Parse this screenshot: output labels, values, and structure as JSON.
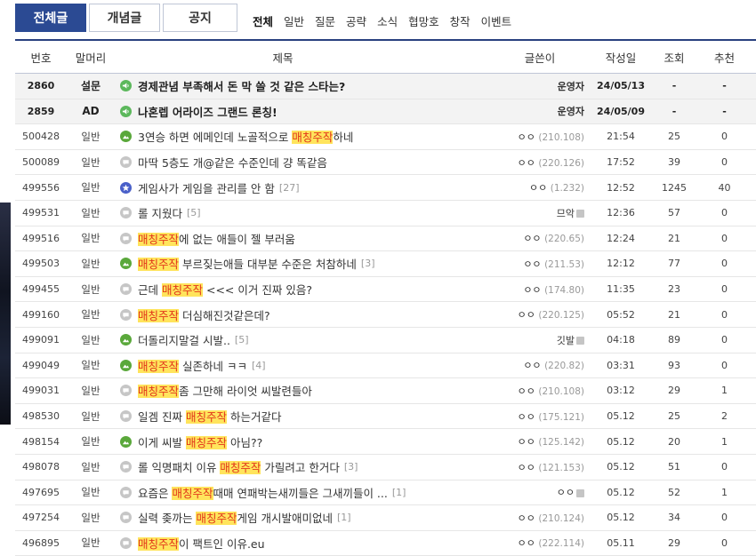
{
  "tabs": [
    {
      "label": "전체글",
      "active": true
    },
    {
      "label": "개념글",
      "active": false
    },
    {
      "label": "공지",
      "active": false
    }
  ],
  "categories": [
    {
      "label": "전체",
      "active": true
    },
    {
      "label": "일반",
      "active": false
    },
    {
      "label": "질문",
      "active": false
    },
    {
      "label": "공략",
      "active": false
    },
    {
      "label": "소식",
      "active": false
    },
    {
      "label": "협망호",
      "active": false
    },
    {
      "label": "창작",
      "active": false
    },
    {
      "label": "이벤트",
      "active": false
    }
  ],
  "columns": {
    "num": "번호",
    "head": "말머리",
    "title": "제목",
    "writer": "글쓴이",
    "date": "작성일",
    "views": "조회",
    "rec": "추천"
  },
  "rows": [
    {
      "num": "2860",
      "head": "설문",
      "icon": "speaker-icon",
      "notice": true,
      "parts": [
        [
          "경제관념 부족해서 돈 막 쓸 것 같은 스타는?",
          false
        ]
      ],
      "count": "",
      "writer": "운영자",
      "ip": "",
      "date": "24/05/13",
      "views": "-",
      "rec": "-"
    },
    {
      "num": "2859",
      "head": "AD",
      "icon": "speaker-icon",
      "notice": true,
      "parts": [
        [
          "나혼렙 어라이즈 그랜드 론칭!",
          false
        ]
      ],
      "count": "",
      "writer": "운영자",
      "ip": "",
      "date": "24/05/09",
      "views": "-",
      "rec": "-"
    },
    {
      "num": "500428",
      "head": "일반",
      "icon": "image-post-icon",
      "parts": [
        [
          "3연승 하면 에메인데 노골적으로 ",
          false
        ],
        [
          "매칭주작",
          true
        ],
        [
          "하네",
          false
        ]
      ],
      "count": "",
      "writer": "ㅇㅇ",
      "ip": "(210.108)",
      "date": "21:54",
      "views": "25",
      "rec": "0"
    },
    {
      "num": "500089",
      "head": "일반",
      "icon": "text-post-icon",
      "parts": [
        [
          "마딱 5층도 개@같은 수준인데 걍 똑같음",
          false
        ]
      ],
      "count": "",
      "writer": "ㅇㅇ",
      "ip": "(220.126)",
      "date": "17:52",
      "views": "39",
      "rec": "0"
    },
    {
      "num": "499556",
      "head": "일반",
      "icon": "star-post-icon",
      "parts": [
        [
          "게임사가 게임을 관리를 안 함",
          false
        ]
      ],
      "count": "[27]",
      "writer": "ㅇㅇ",
      "ip": "(1.232)",
      "date": "12:52",
      "views": "1245",
      "rec": "40"
    },
    {
      "num": "499531",
      "head": "일반",
      "icon": "text-post-icon",
      "parts": [
        [
          "롤 지웠다",
          false
        ]
      ],
      "count": "[5]",
      "writer": "므악",
      "ip": "",
      "date": "12:36",
      "views": "57",
      "rec": "0",
      "level": true
    },
    {
      "num": "499516",
      "head": "일반",
      "icon": "text-post-icon",
      "parts": [
        [
          "매칭주작",
          true
        ],
        [
          "에 없는 애들이 젤 부러움",
          false
        ]
      ],
      "count": "",
      "writer": "ㅇㅇ",
      "ip": "(220.65)",
      "date": "12:24",
      "views": "21",
      "rec": "0"
    },
    {
      "num": "499503",
      "head": "일반",
      "icon": "image-post-icon",
      "parts": [
        [
          "매칭주작",
          true
        ],
        [
          " 부르짖는애들 대부분 수준은 처참하네",
          false
        ]
      ],
      "count": "[3]",
      "writer": "ㅇㅇ",
      "ip": "(211.53)",
      "date": "12:12",
      "views": "77",
      "rec": "0"
    },
    {
      "num": "499455",
      "head": "일반",
      "icon": "text-post-icon",
      "parts": [
        [
          "근데 ",
          false
        ],
        [
          "매칭주작",
          true
        ],
        [
          " <<< 이거 진짜 있음?",
          false
        ]
      ],
      "count": "",
      "writer": "ㅇㅇ",
      "ip": "(174.80)",
      "date": "11:35",
      "views": "23",
      "rec": "0"
    },
    {
      "num": "499160",
      "head": "일반",
      "icon": "text-post-icon",
      "parts": [
        [
          "매칭주작",
          true
        ],
        [
          " 더심해진것같은데?",
          false
        ]
      ],
      "count": "",
      "writer": "ㅇㅇ",
      "ip": "(220.125)",
      "date": "05:52",
      "views": "21",
      "rec": "0"
    },
    {
      "num": "499091",
      "head": "일반",
      "icon": "image-post-icon",
      "parts": [
        [
          "더돌리지말걸 시발..",
          false
        ]
      ],
      "count": "[5]",
      "writer": "깃발",
      "ip": "",
      "date": "04:18",
      "views": "89",
      "rec": "0",
      "level": true
    },
    {
      "num": "499049",
      "head": "일반",
      "icon": "image-post-icon",
      "parts": [
        [
          "매칭주작",
          true
        ],
        [
          " 실존하네 ㅋㅋ",
          false
        ]
      ],
      "count": "[4]",
      "writer": "ㅇㅇ",
      "ip": "(220.82)",
      "date": "03:31",
      "views": "93",
      "rec": "0"
    },
    {
      "num": "499031",
      "head": "일반",
      "icon": "text-post-icon",
      "parts": [
        [
          "매칭주작",
          true
        ],
        [
          "좀 그만해 라이엇 씨발련들아",
          false
        ]
      ],
      "count": "",
      "writer": "ㅇㅇ",
      "ip": "(210.108)",
      "date": "03:12",
      "views": "29",
      "rec": "1"
    },
    {
      "num": "498530",
      "head": "일반",
      "icon": "text-post-icon",
      "parts": [
        [
          "일겜 진짜 ",
          false
        ],
        [
          "매칭주작",
          true
        ],
        [
          " 하는거같다",
          false
        ]
      ],
      "count": "",
      "writer": "ㅇㅇ",
      "ip": "(175.121)",
      "date": "05.12",
      "views": "25",
      "rec": "2"
    },
    {
      "num": "498154",
      "head": "일반",
      "icon": "image-post-icon",
      "parts": [
        [
          "이게 씨발 ",
          false
        ],
        [
          "매칭주작",
          true
        ],
        [
          " 아님??",
          false
        ]
      ],
      "count": "",
      "writer": "ㅇㅇ",
      "ip": "(125.142)",
      "date": "05.12",
      "views": "20",
      "rec": "1"
    },
    {
      "num": "498078",
      "head": "일반",
      "icon": "text-post-icon",
      "parts": [
        [
          "롤 익명패치 이유 ",
          false
        ],
        [
          "매칭주작",
          true
        ],
        [
          " 가릴려고 한거다",
          false
        ]
      ],
      "count": "[3]",
      "writer": "ㅇㅇ",
      "ip": "(121.153)",
      "date": "05.12",
      "views": "51",
      "rec": "0"
    },
    {
      "num": "497695",
      "head": "일반",
      "icon": "text-post-icon",
      "parts": [
        [
          "요즘은 ",
          false
        ],
        [
          "매칭주작",
          true
        ],
        [
          "때매 연패박는새끼들은 그새끼들이 ...",
          false
        ]
      ],
      "count": "[1]",
      "writer": "ㅇㅇ",
      "ip": "",
      "date": "05.12",
      "views": "52",
      "rec": "1",
      "level": true
    },
    {
      "num": "497254",
      "head": "일반",
      "icon": "text-post-icon",
      "parts": [
        [
          "실력 좆까는 ",
          false
        ],
        [
          "매칭주작",
          true
        ],
        [
          "게임 개시발애미없네",
          false
        ]
      ],
      "count": "[1]",
      "writer": "ㅇㅇ",
      "ip": "(210.124)",
      "date": "05.12",
      "views": "34",
      "rec": "0"
    },
    {
      "num": "496895",
      "head": "일반",
      "icon": "text-post-icon",
      "parts": [
        [
          "매칭주작",
          true
        ],
        [
          "이 팩트인 이유.eu",
          false
        ]
      ],
      "count": "",
      "writer": "ㅇㅇ",
      "ip": "(222.114)",
      "date": "05.11",
      "views": "29",
      "rec": "0"
    }
  ]
}
